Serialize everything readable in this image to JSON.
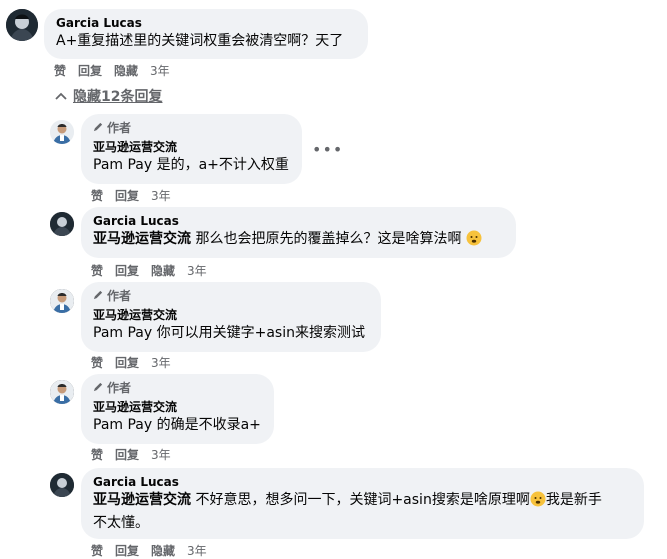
{
  "comments": [
    {
      "name": "Garcia Lucas",
      "text": "A+重复描述里的关键词权重会被清空啊？天了",
      "actions": [
        "赞",
        "回复",
        "隐藏"
      ],
      "time": "3年"
    }
  ],
  "collapse_label": "隐藏12条回复",
  "replies": [
    {
      "author_tag": "作者",
      "name": "亚马逊运营交流",
      "text": "Pam Pay 是的，a+不计入权重",
      "actions": [
        "赞",
        "回复"
      ],
      "time": "3年"
    },
    {
      "name": "Garcia Lucas",
      "mention": "亚马逊运营交流",
      "text": "那么也会把原先的覆盖掉么？这是啥算法啊",
      "actions": [
        "赞",
        "回复",
        "隐藏"
      ],
      "time": "3年"
    },
    {
      "author_tag": "作者",
      "name": "亚马逊运营交流",
      "text": "Pam Pay 你可以用关键字+asin来搜索测试",
      "actions": [
        "赞",
        "回复"
      ],
      "time": "3年"
    },
    {
      "author_tag": "作者",
      "name": "亚马逊运营交流",
      "text": "Pam Pay 的确是不收录a+",
      "actions": [
        "赞",
        "回复"
      ],
      "time": "3年"
    },
    {
      "name": "Garcia Lucas",
      "mention": "亚马逊运营交流",
      "text_1": "不好意思，想多问一下，关键词+asin搜索是啥原理啊",
      "text_2": "我是新手",
      "text_3": "不太懂。",
      "actions": [
        "赞",
        "回复",
        "隐藏"
      ],
      "time": "3年"
    }
  ],
  "more_icon": "more-options-icon",
  "colors": {
    "bubble": "#f0f2f5",
    "meta": "#65676b",
    "text": "#050505"
  }
}
